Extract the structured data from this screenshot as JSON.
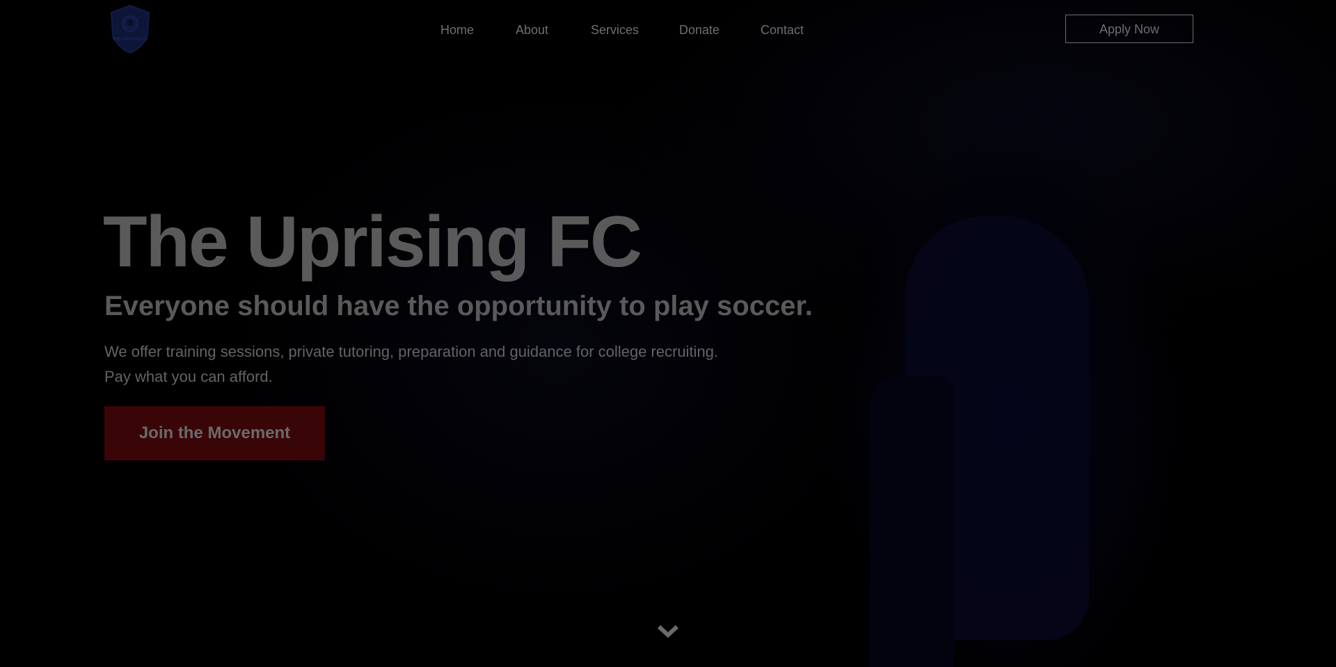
{
  "brand": {
    "logo_text": "THE UPRISING FC",
    "logo_color": "#0d1538"
  },
  "nav": {
    "items": [
      {
        "label": "Home"
      },
      {
        "label": "About"
      },
      {
        "label": "Services"
      },
      {
        "label": "Donate"
      },
      {
        "label": "Contact"
      }
    ],
    "apply_label": "Apply Now"
  },
  "hero": {
    "title": "The Uprising FC",
    "subtitle": "Everyone should have the opportunity to play soccer.",
    "description_line1": "We offer training sessions, private tutoring, preparation and guidance for college recruiting.",
    "description_line2": "Pay what you can afford.",
    "cta_label": "Join the Movement",
    "cta_color": "#3a0507",
    "scroll_icon": "chevron-down-icon"
  }
}
